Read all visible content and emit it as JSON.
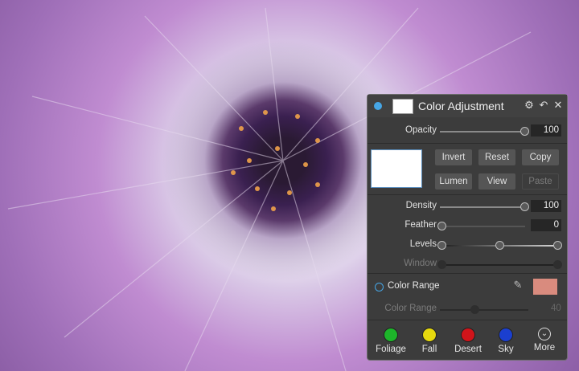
{
  "panel": {
    "title": "Color Adjustment",
    "header_icons": [
      "gear-icon",
      "undo-icon",
      "close-icon"
    ],
    "opacity": {
      "label": "Opacity",
      "value": "100"
    },
    "buttons": {
      "invert": "Invert",
      "reset": "Reset",
      "copy": "Copy",
      "lumen": "Lumen",
      "view": "View",
      "paste": "Paste"
    },
    "density": {
      "label": "Density",
      "value": "100"
    },
    "feather": {
      "label": "Feather",
      "value": "0"
    },
    "levels": {
      "label": "Levels"
    },
    "window": {
      "label": "Window"
    },
    "color_range_toggle": {
      "label": "Color Range"
    },
    "color_range_slider": {
      "label": "Color Range",
      "value": "40"
    },
    "color_range_swatch": "#d98b7e",
    "presets": [
      {
        "label": "Foliage",
        "color": "#1db52a"
      },
      {
        "label": "Fall",
        "color": "#e6d90e"
      },
      {
        "label": "Desert",
        "color": "#d0141a"
      },
      {
        "label": "Sky",
        "color": "#1b3fcf"
      },
      {
        "label": "More",
        "icon": "chevron-down-circle-icon"
      }
    ],
    "accent": "#46a6e6"
  }
}
